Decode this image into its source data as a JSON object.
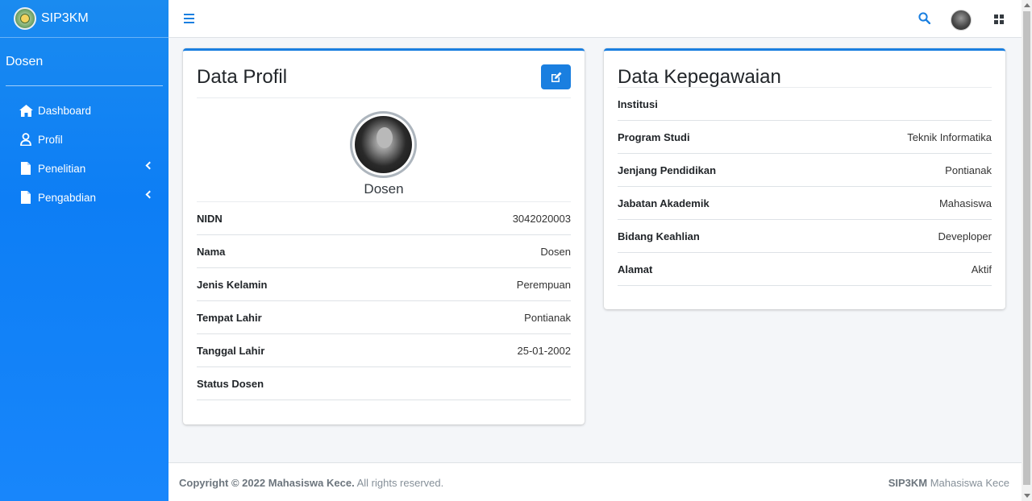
{
  "brand": {
    "name": "SIP3KM"
  },
  "user": {
    "name": "Dosen"
  },
  "sidebar": {
    "items": [
      {
        "label": "Dashboard",
        "icon": "home-icon"
      },
      {
        "label": "Profil",
        "icon": "user-icon"
      },
      {
        "label": "Penelitian",
        "icon": "file-icon"
      },
      {
        "label": "Pengabdian",
        "icon": "file-icon"
      }
    ]
  },
  "profil": {
    "title": "Data Profil",
    "name": "Dosen",
    "rows": [
      {
        "label": "NIDN",
        "value": "3042020003"
      },
      {
        "label": "Nama",
        "value": "Dosen"
      },
      {
        "label": "Jenis Kelamin",
        "value": "Perempuan"
      },
      {
        "label": "Tempat Lahir",
        "value": "Pontianak"
      },
      {
        "label": "Tanggal Lahir",
        "value": "25-01-2002"
      },
      {
        "label": "Status Dosen",
        "value": ""
      }
    ]
  },
  "kepegawaian": {
    "title": "Data Kepegawaian",
    "rows": [
      {
        "label": "Institusi",
        "value": ""
      },
      {
        "label": "Program Studi",
        "value": "Teknik Informatika"
      },
      {
        "label": "Jenjang Pendidikan",
        "value": "Pontianak"
      },
      {
        "label": "Jabatan Akademik",
        "value": "Mahasiswa"
      },
      {
        "label": "Bidang Keahlian",
        "value": "Deveploper"
      },
      {
        "label": "Alamat",
        "value": "Aktif"
      }
    ]
  },
  "footer": {
    "copyright_prefix": "Copyright © 2022",
    "copyright_owner": "Mahasiswa Kece.",
    "copyright_suffix": "All rights reserved.",
    "right_brand": "SIP3KM",
    "right_text": "Mahasiswa Kece"
  },
  "colors": {
    "primary": "#1a7fe0",
    "sidebar": "#0d7ef5"
  }
}
